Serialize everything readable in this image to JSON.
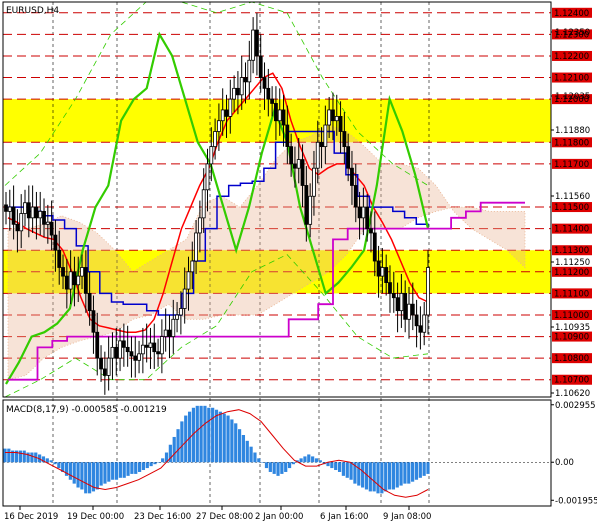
{
  "window": {
    "title": "EURUSD,H4"
  },
  "colors": {
    "zone": "#ffff00",
    "red_line": "#ff0000",
    "resistance_line": "#cc0000",
    "grid": "#000000",
    "green_line": "#33cc00",
    "blue_line": "#0000cc",
    "magenta_line": "#cc00cc",
    "cloud": "#e8b08c",
    "macd_bar": "#2f86e0",
    "macd_signal": "#dd0000",
    "candle": "#000000",
    "price_tag_bg": "#dd0000",
    "price_tag_text": "#ffffff"
  },
  "chart_data": [
    {
      "type": "candlestick",
      "title": "EURUSD,H4",
      "ylim": [
        1.1062,
        1.1245
      ],
      "x_ticks": [
        "16 Dec 2019",
        "19 Dec 00:00",
        "23 Dec 16:00",
        "27 Dec 08:00",
        "2 Jan 00:00",
        "6 Jan 16:00",
        "9 Jan 08:00"
      ],
      "price_scale_labels": [
        "1.12350",
        "1.12035",
        "1.11880",
        "1.11560",
        "1.11250",
        "1.10935",
        "1.10620"
      ],
      "levels": [
        1.124,
        1.123,
        1.122,
        1.121,
        1.12,
        1.118,
        1.117,
        1.115,
        1.114,
        1.113,
        1.112,
        1.111,
        1.11,
        1.109,
        1.108,
        1.107
      ],
      "level_labels": [
        "1.12400",
        "1.12300",
        "1.12200",
        "1.12100",
        "1.12000",
        "1.11800",
        "1.11700",
        "1.11500",
        "1.11400",
        "1.11300",
        "1.11200",
        "1.11100",
        "1.11000",
        "1.10900",
        "1.10800",
        "1.10700"
      ],
      "highlighted_zones": [
        [
          1.118,
          1.12
        ],
        [
          1.111,
          1.113
        ]
      ],
      "closes": [
        1.1148,
        1.115,
        1.1142,
        1.1139,
        1.1147,
        1.1152,
        1.1145,
        1.115,
        1.1145,
        1.1148,
        1.1142,
        1.1143,
        1.1137,
        1.113,
        1.1122,
        1.1118,
        1.1112,
        1.112,
        1.1114,
        1.1118,
        1.1122,
        1.111,
        1.1102,
        1.1092,
        1.108,
        1.1075,
        1.1072,
        1.108,
        1.1085,
        1.108,
        1.1088,
        1.1085,
        1.1083,
        1.1081,
        1.1079,
        1.1082,
        1.1086,
        1.1085,
        1.1087,
        1.1083,
        1.1082,
        1.109,
        1.1093,
        1.109,
        1.1098,
        1.11,
        1.1103,
        1.1112,
        1.112,
        1.1125,
        1.1138,
        1.1145,
        1.1158,
        1.117,
        1.1178,
        1.1185,
        1.119,
        1.1195,
        1.1192,
        1.12,
        1.1205,
        1.1202,
        1.121,
        1.1208,
        1.1218,
        1.1232,
        1.122,
        1.121,
        1.1205,
        1.12,
        1.1198,
        1.119,
        1.1195,
        1.1188,
        1.1178,
        1.117,
        1.1168,
        1.1172,
        1.116,
        1.1142,
        1.1155,
        1.1168,
        1.118,
        1.1178,
        1.1188,
        1.1195,
        1.119,
        1.1192,
        1.1185,
        1.1178,
        1.1168,
        1.116,
        1.115,
        1.1145,
        1.115,
        1.114,
        1.1138,
        1.1125,
        1.1118,
        1.1122,
        1.1115,
        1.111,
        1.1108,
        1.1102,
        1.111,
        1.1098,
        1.1105,
        1.11,
        1.1095,
        1.1092,
        1.11,
        1.1122
      ],
      "series": [
        {
          "name": "",
          "color_key": "red_line",
          "values": [
            1.1145,
            1.1143,
            1.114,
            1.1138,
            1.1136,
            1.1135,
            1.113,
            1.112,
            1.1108,
            1.1098,
            1.1095,
            1.1094,
            1.1093,
            1.1092,
            1.1092,
            1.1093,
            1.1098,
            1.111,
            1.1125,
            1.114,
            1.115,
            1.116,
            1.1168,
            1.118,
            1.119,
            1.1195,
            1.12,
            1.1205,
            1.121,
            1.1212,
            1.1205,
            1.119,
            1.1178,
            1.1168,
            1.1165,
            1.1168,
            1.117,
            1.117,
            1.1165,
            1.116,
            1.115,
            1.1143,
            1.1135,
            1.1125,
            1.1115,
            1.1108,
            1.1106
          ]
        },
        {
          "name": "",
          "color_key": "blue_line",
          "values": [
            1.115,
            1.115,
            1.1148,
            1.1146,
            1.1144,
            1.114,
            1.1132,
            1.112,
            1.111,
            1.1106,
            1.1105,
            1.1105,
            1.1102,
            1.11,
            1.11,
            1.111,
            1.1125,
            1.114,
            1.1155,
            1.116,
            1.1161,
            1.1162,
            1.1168,
            1.118,
            1.1185,
            1.1185,
            1.1185,
            1.1185,
            1.1175,
            1.1165,
            1.1155,
            1.115,
            1.115,
            1.1148,
            1.1145,
            1.1142,
            1.114
          ]
        },
        {
          "name": "",
          "color_key": "green_line",
          "values": [
            1.1068,
            1.1078,
            1.109,
            1.1092,
            1.1096,
            1.1103,
            1.113,
            1.115,
            1.116,
            1.119,
            1.12,
            1.1205,
            1.123,
            1.122,
            1.12,
            1.118,
            1.117,
            1.115,
            1.113,
            1.115,
            1.1175,
            1.1195,
            1.118,
            1.115,
            1.113,
            1.111,
            1.1115,
            1.1122,
            1.113,
            1.116,
            1.12,
            1.1185,
            1.1165,
            1.114
          ]
        },
        {
          "name": "",
          "color_key": "magenta_line",
          "values": [
            1.107,
            1.107,
            1.1085,
            1.1088,
            1.109,
            1.109,
            1.109,
            1.109,
            1.109,
            1.109,
            1.109,
            1.109,
            1.109,
            1.109,
            1.109,
            1.109,
            1.109,
            1.109,
            1.109,
            1.1098,
            1.1098,
            1.1105,
            1.1135,
            1.114,
            1.114,
            1.114,
            1.114,
            1.114,
            1.114,
            1.114,
            1.1145,
            1.1148,
            1.1152,
            1.1152,
            1.1152,
            1.1152
          ]
        }
      ]
    },
    {
      "type": "bar",
      "title": "MACD(8,17,9) -0.000585 -0.001219",
      "ylim": [
        -0.00225,
        0.0032
      ],
      "price_scale_labels": [
        "0.002955",
        "0.00",
        "-0.001955"
      ],
      "histogram": [
        0.0007,
        0.0007,
        0.0006,
        0.0006,
        0.0006,
        0.0006,
        0.0005,
        0.0005,
        0.0005,
        0.0004,
        0.0003,
        0.0002,
        0.0001,
        -0.0001,
        -0.0003,
        -0.0005,
        -0.0007,
        -0.0009,
        -0.0011,
        -0.0013,
        -0.0014,
        -0.0016,
        -0.0016,
        -0.0015,
        -0.0014,
        -0.0012,
        -0.0011,
        -0.001,
        -0.0009,
        -0.0009,
        -0.0008,
        -0.0008,
        -0.0007,
        -0.0006,
        -0.0006,
        -0.0005,
        -0.0004,
        -0.0003,
        -0.0002,
        -0.0001,
        0.0,
        0.0002,
        0.0005,
        0.0009,
        0.0013,
        0.0017,
        0.0021,
        0.0024,
        0.0026,
        0.0028,
        0.0029,
        0.0029,
        0.0029,
        0.0028,
        0.0028,
        0.0027,
        0.0026,
        0.0025,
        0.0024,
        0.0022,
        0.002,
        0.0017,
        0.0014,
        0.0011,
        0.0008,
        0.0005,
        0.0002,
        0.0,
        -0.0003,
        -0.0005,
        -0.0006,
        -0.0007,
        -0.0006,
        -0.0005,
        -0.0003,
        -0.0001,
        0.0001,
        0.0002,
        0.0003,
        0.0004,
        0.0003,
        0.0002,
        0.0001,
        -0.0001,
        -0.0002,
        -0.0003,
        -0.0004,
        -0.0005,
        -0.0007,
        -0.0008,
        -0.0009,
        -0.0011,
        -0.0012,
        -0.0013,
        -0.0014,
        -0.0015,
        -0.0015,
        -0.0016,
        -0.0016,
        -0.0015,
        -0.0014,
        -0.0014,
        -0.0013,
        -0.0012,
        -0.0011,
        -0.0011,
        -0.001,
        -0.0009,
        -0.0008,
        -0.0007,
        -0.0006
      ],
      "signal": [
        0.0005,
        0.0005,
        0.0004,
        0.0002,
        -0.0001,
        -0.0004,
        -0.0007,
        -0.001,
        -0.0013,
        -0.0014,
        -0.0013,
        -0.0011,
        -0.0009,
        -0.0006,
        -0.0003,
        0.0003,
        0.0009,
        0.0015,
        0.002,
        0.0024,
        0.0026,
        0.0027,
        0.0025,
        0.0021,
        0.0014,
        0.0007,
        0.0001,
        -0.0002,
        -0.0002,
        0.0,
        0.0001,
        0.0,
        -0.0004,
        -0.0009,
        -0.0014,
        -0.0017,
        -0.0018,
        -0.0017,
        -0.0014
      ]
    }
  ]
}
